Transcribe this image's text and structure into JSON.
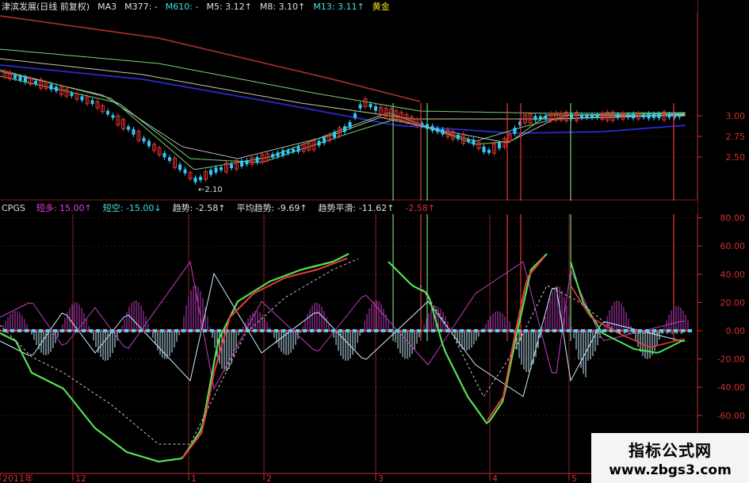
{
  "colors": {
    "bg": "#000000",
    "price_up": "#e03030",
    "price_down": "#30c8ff",
    "ma_red": "#b03030",
    "ma_blue": "#2a2acf",
    "ma_green": "#7ad07a",
    "ma_light": "#c8c8a0",
    "osc_green": "#55e055",
    "osc_red": "#e83a3a",
    "hist_pos": "#c040c0",
    "hist_neg": "#c8f0ff",
    "zero_line": "#e03838",
    "zero_dots": "#50d0ff",
    "grid": "#8a2020",
    "axis_text": "#d03030",
    "t_red": "#e03030",
    "t_magenta": "#e040e0",
    "t_cyan": "#40e0e0",
    "t_white": "#e0e0e0",
    "t_yellow": "#f0e020"
  },
  "header": {
    "segments": [
      {
        "text": "津滨发展(日线 前复权)",
        "color": "t_white"
      },
      {
        "text": "MA3",
        "color": "t_white"
      },
      {
        "text": "M377: -",
        "color": "t_white"
      },
      {
        "text": "M610: -",
        "color": "t_cyan"
      },
      {
        "text": "M5: 3.12↑",
        "color": "t_white"
      },
      {
        "text": "M8: 3.10↑",
        "color": "t_white"
      },
      {
        "text": "M13: 3.11↑",
        "color": "t_cyan"
      },
      {
        "text": "黄金",
        "color": "t_yellow"
      }
    ]
  },
  "indicator_header": {
    "segments": [
      {
        "text": "CPGS",
        "color": "t_white"
      },
      {
        "text": "短多: 15.00↑",
        "color": "t_magenta"
      },
      {
        "text": "短空: -15.00↓",
        "color": "t_cyan"
      },
      {
        "text": "趋势: -2.58↑",
        "color": "t_white"
      },
      {
        "text": "平均趋势: -9.69↑",
        "color": "t_white"
      },
      {
        "text": "趋势平滑: -11.62↑",
        "color": "t_white"
      },
      {
        "text": "-2.58↑",
        "color": "t_red"
      }
    ]
  },
  "price_axis": [
    "3.00",
    "2.75",
    "2.50"
  ],
  "osc_axis": [
    "80.00",
    "60.00",
    "40.00",
    "20.00",
    "0.00",
    "-20.00",
    "-40.00",
    "-60.00"
  ],
  "low_annotation": "←2.10",
  "date_axis": [
    "2011年",
    "12",
    "1",
    "2",
    "3",
    "4",
    "5"
  ],
  "watermark": {
    "title": "指标公式网",
    "url": "www.zbgs3.com"
  }
}
